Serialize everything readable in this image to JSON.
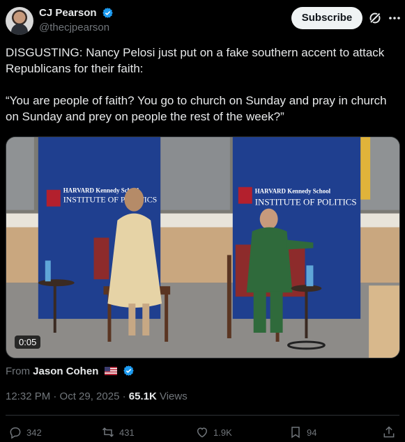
{
  "author": {
    "display_name": "CJ Pearson",
    "handle": "@thecjpearson"
  },
  "header": {
    "subscribe_label": "Subscribe"
  },
  "tweet": {
    "text": "DISGUSTING: Nancy Pelosi just put on a fake southern accent to attack Republicans for their faith:\n\n“You are people of faith? You go to church on Sunday and pray in church on Sunday and prey on people the rest of the week?”"
  },
  "media": {
    "duration": "0:05",
    "banner_left_line1": "HARVARD Kennedy School",
    "banner_left_line2": "INSTITUTE OF POLITICS",
    "banner_right_line1": "HARVARD Kennedy School",
    "banner_right_line2": "INSTITUTE OF POLITICS"
  },
  "source": {
    "prefix": "From",
    "name": "Jason Cohen"
  },
  "meta": {
    "time_date": "12:32 PM · Oct 29, 2025 · ",
    "views_count": "65.1K",
    "views_label": "Views"
  },
  "actions": {
    "replies": "342",
    "reposts": "431",
    "likes": "1.9K",
    "bookmarks": "94"
  },
  "icons": [
    "verified-badge-icon",
    "grok-icon",
    "more-icon",
    "us-flag-icon",
    "reply-icon",
    "repost-icon",
    "like-icon",
    "bookmark-icon",
    "share-icon"
  ],
  "colors": {
    "background": "#000000",
    "text": "#e7e9ea",
    "muted": "#71767b",
    "verified": "#1d9bf0",
    "banner": "#1f3f8f"
  }
}
